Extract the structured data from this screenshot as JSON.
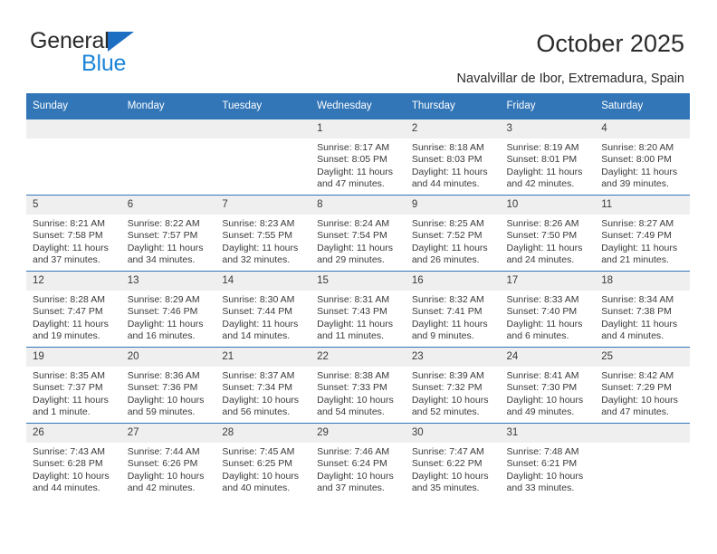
{
  "brand": {
    "name_top": "General",
    "name_bottom": "Blue",
    "triangle_color": "#1b6ec2",
    "blue_color": "#1c84d8"
  },
  "header": {
    "title": "October 2025",
    "subtitle": "Navalvillar de Ibor, Extremadura, Spain"
  },
  "theme": {
    "header_row_bg": "#3276b8",
    "header_row_text": "#ffffff",
    "daynum_bg": "#efefef",
    "row_border": "#3276b8",
    "body_text": "#3a3a3a"
  },
  "calendar": {
    "weekday_headers": [
      "Sunday",
      "Monday",
      "Tuesday",
      "Wednesday",
      "Thursday",
      "Friday",
      "Saturday"
    ],
    "weeks": [
      [
        {
          "day": "",
          "empty": true
        },
        {
          "day": "",
          "empty": true
        },
        {
          "day": "",
          "empty": true
        },
        {
          "day": "1",
          "sunrise": "Sunrise: 8:17 AM",
          "sunset": "Sunset: 8:05 PM",
          "daylight1": "Daylight: 11 hours",
          "daylight2": "and 47 minutes."
        },
        {
          "day": "2",
          "sunrise": "Sunrise: 8:18 AM",
          "sunset": "Sunset: 8:03 PM",
          "daylight1": "Daylight: 11 hours",
          "daylight2": "and 44 minutes."
        },
        {
          "day": "3",
          "sunrise": "Sunrise: 8:19 AM",
          "sunset": "Sunset: 8:01 PM",
          "daylight1": "Daylight: 11 hours",
          "daylight2": "and 42 minutes."
        },
        {
          "day": "4",
          "sunrise": "Sunrise: 8:20 AM",
          "sunset": "Sunset: 8:00 PM",
          "daylight1": "Daylight: 11 hours",
          "daylight2": "and 39 minutes."
        }
      ],
      [
        {
          "day": "5",
          "sunrise": "Sunrise: 8:21 AM",
          "sunset": "Sunset: 7:58 PM",
          "daylight1": "Daylight: 11 hours",
          "daylight2": "and 37 minutes."
        },
        {
          "day": "6",
          "sunrise": "Sunrise: 8:22 AM",
          "sunset": "Sunset: 7:57 PM",
          "daylight1": "Daylight: 11 hours",
          "daylight2": "and 34 minutes."
        },
        {
          "day": "7",
          "sunrise": "Sunrise: 8:23 AM",
          "sunset": "Sunset: 7:55 PM",
          "daylight1": "Daylight: 11 hours",
          "daylight2": "and 32 minutes."
        },
        {
          "day": "8",
          "sunrise": "Sunrise: 8:24 AM",
          "sunset": "Sunset: 7:54 PM",
          "daylight1": "Daylight: 11 hours",
          "daylight2": "and 29 minutes."
        },
        {
          "day": "9",
          "sunrise": "Sunrise: 8:25 AM",
          "sunset": "Sunset: 7:52 PM",
          "daylight1": "Daylight: 11 hours",
          "daylight2": "and 26 minutes."
        },
        {
          "day": "10",
          "sunrise": "Sunrise: 8:26 AM",
          "sunset": "Sunset: 7:50 PM",
          "daylight1": "Daylight: 11 hours",
          "daylight2": "and 24 minutes."
        },
        {
          "day": "11",
          "sunrise": "Sunrise: 8:27 AM",
          "sunset": "Sunset: 7:49 PM",
          "daylight1": "Daylight: 11 hours",
          "daylight2": "and 21 minutes."
        }
      ],
      [
        {
          "day": "12",
          "sunrise": "Sunrise: 8:28 AM",
          "sunset": "Sunset: 7:47 PM",
          "daylight1": "Daylight: 11 hours",
          "daylight2": "and 19 minutes."
        },
        {
          "day": "13",
          "sunrise": "Sunrise: 8:29 AM",
          "sunset": "Sunset: 7:46 PM",
          "daylight1": "Daylight: 11 hours",
          "daylight2": "and 16 minutes."
        },
        {
          "day": "14",
          "sunrise": "Sunrise: 8:30 AM",
          "sunset": "Sunset: 7:44 PM",
          "daylight1": "Daylight: 11 hours",
          "daylight2": "and 14 minutes."
        },
        {
          "day": "15",
          "sunrise": "Sunrise: 8:31 AM",
          "sunset": "Sunset: 7:43 PM",
          "daylight1": "Daylight: 11 hours",
          "daylight2": "and 11 minutes."
        },
        {
          "day": "16",
          "sunrise": "Sunrise: 8:32 AM",
          "sunset": "Sunset: 7:41 PM",
          "daylight1": "Daylight: 11 hours",
          "daylight2": "and 9 minutes."
        },
        {
          "day": "17",
          "sunrise": "Sunrise: 8:33 AM",
          "sunset": "Sunset: 7:40 PM",
          "daylight1": "Daylight: 11 hours",
          "daylight2": "and 6 minutes."
        },
        {
          "day": "18",
          "sunrise": "Sunrise: 8:34 AM",
          "sunset": "Sunset: 7:38 PM",
          "daylight1": "Daylight: 11 hours",
          "daylight2": "and 4 minutes."
        }
      ],
      [
        {
          "day": "19",
          "sunrise": "Sunrise: 8:35 AM",
          "sunset": "Sunset: 7:37 PM",
          "daylight1": "Daylight: 11 hours",
          "daylight2": "and 1 minute."
        },
        {
          "day": "20",
          "sunrise": "Sunrise: 8:36 AM",
          "sunset": "Sunset: 7:36 PM",
          "daylight1": "Daylight: 10 hours",
          "daylight2": "and 59 minutes."
        },
        {
          "day": "21",
          "sunrise": "Sunrise: 8:37 AM",
          "sunset": "Sunset: 7:34 PM",
          "daylight1": "Daylight: 10 hours",
          "daylight2": "and 56 minutes."
        },
        {
          "day": "22",
          "sunrise": "Sunrise: 8:38 AM",
          "sunset": "Sunset: 7:33 PM",
          "daylight1": "Daylight: 10 hours",
          "daylight2": "and 54 minutes."
        },
        {
          "day": "23",
          "sunrise": "Sunrise: 8:39 AM",
          "sunset": "Sunset: 7:32 PM",
          "daylight1": "Daylight: 10 hours",
          "daylight2": "and 52 minutes."
        },
        {
          "day": "24",
          "sunrise": "Sunrise: 8:41 AM",
          "sunset": "Sunset: 7:30 PM",
          "daylight1": "Daylight: 10 hours",
          "daylight2": "and 49 minutes."
        },
        {
          "day": "25",
          "sunrise": "Sunrise: 8:42 AM",
          "sunset": "Sunset: 7:29 PM",
          "daylight1": "Daylight: 10 hours",
          "daylight2": "and 47 minutes."
        }
      ],
      [
        {
          "day": "26",
          "sunrise": "Sunrise: 7:43 AM",
          "sunset": "Sunset: 6:28 PM",
          "daylight1": "Daylight: 10 hours",
          "daylight2": "and 44 minutes."
        },
        {
          "day": "27",
          "sunrise": "Sunrise: 7:44 AM",
          "sunset": "Sunset: 6:26 PM",
          "daylight1": "Daylight: 10 hours",
          "daylight2": "and 42 minutes."
        },
        {
          "day": "28",
          "sunrise": "Sunrise: 7:45 AM",
          "sunset": "Sunset: 6:25 PM",
          "daylight1": "Daylight: 10 hours",
          "daylight2": "and 40 minutes."
        },
        {
          "day": "29",
          "sunrise": "Sunrise: 7:46 AM",
          "sunset": "Sunset: 6:24 PM",
          "daylight1": "Daylight: 10 hours",
          "daylight2": "and 37 minutes."
        },
        {
          "day": "30",
          "sunrise": "Sunrise: 7:47 AM",
          "sunset": "Sunset: 6:22 PM",
          "daylight1": "Daylight: 10 hours",
          "daylight2": "and 35 minutes."
        },
        {
          "day": "31",
          "sunrise": "Sunrise: 7:48 AM",
          "sunset": "Sunset: 6:21 PM",
          "daylight1": "Daylight: 10 hours",
          "daylight2": "and 33 minutes."
        },
        {
          "day": "",
          "empty": true
        }
      ]
    ]
  }
}
